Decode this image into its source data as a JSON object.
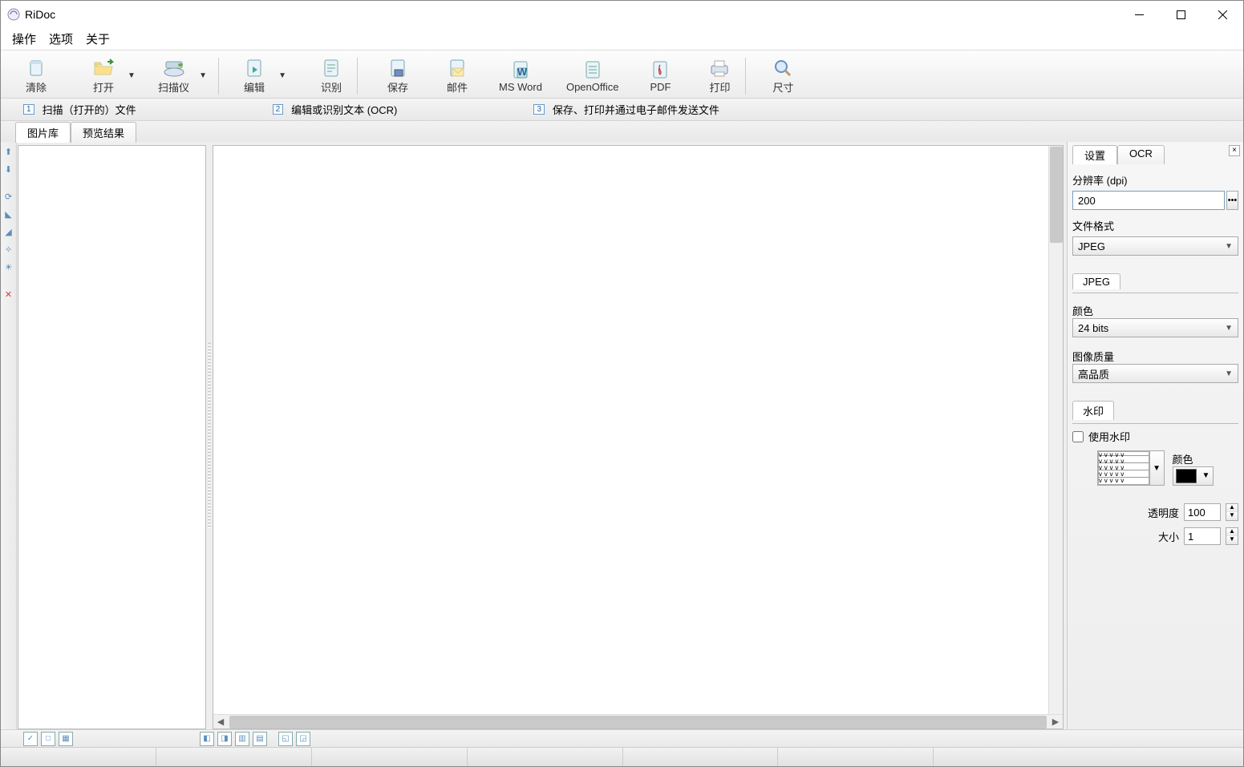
{
  "window": {
    "title": "RiDoc"
  },
  "menu": {
    "action": "操作",
    "options": "选项",
    "about": "关于"
  },
  "toolbar": {
    "clear": "清除",
    "open": "打开",
    "scanner": "扫描仪",
    "edit": "编辑",
    "recognize": "识别",
    "save": "保存",
    "mail": "邮件",
    "msword": "MS Word",
    "openoffice": "OpenOffice",
    "pdf": "PDF",
    "print": "打印",
    "size": "尺寸"
  },
  "hints": {
    "h1": "扫描（打开的）文件",
    "h2": "编辑或识别文本 (OCR)",
    "h3": "保存、打印并通过电子邮件发送文件"
  },
  "tabs": {
    "gallery": "图片库",
    "preview": "预览结果"
  },
  "right": {
    "tab_settings": "设置",
    "tab_ocr": "OCR",
    "dpi_label": "分辨率 (dpi)",
    "dpi_value": "200",
    "format_label": "文件格式",
    "format_value": "JPEG",
    "jpeg_tab": "JPEG",
    "color_label": "颜色",
    "color_value": "24 bits",
    "quality_label": "图像质量",
    "quality_value": "高品质",
    "wm_tab": "水印",
    "wm_use": "使用水印",
    "wm_color_label": "颜色",
    "opacity_label": "透明度",
    "opacity_value": "100",
    "size_label": "大小",
    "size_value": "1"
  }
}
